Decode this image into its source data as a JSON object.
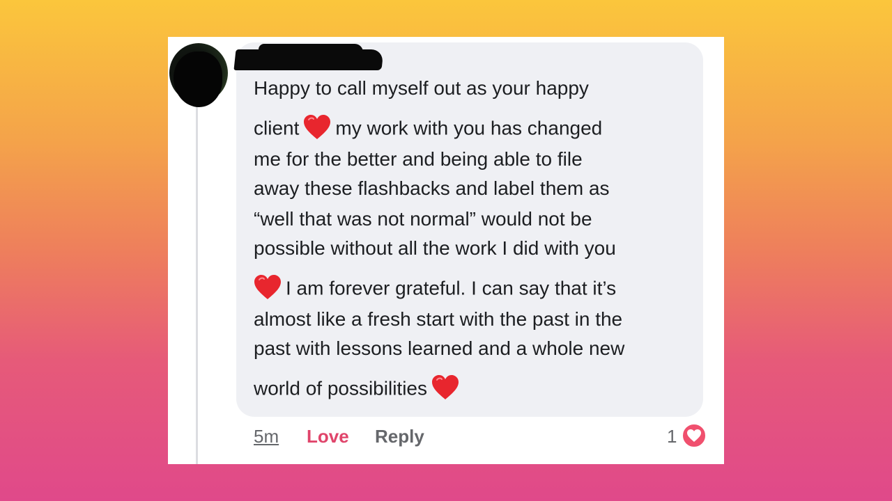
{
  "comment": {
    "lines": [
      [
        "Happy to call myself out as your happy",
        "",
        ""
      ],
      [
        "client",
        "red-heart-emoji",
        "my work with you has changed"
      ],
      [
        "me for the better and being able to file",
        "",
        ""
      ],
      [
        "away these flashbacks and label them as",
        "",
        ""
      ],
      [
        "“well that was not normal” would not be",
        "",
        ""
      ],
      [
        "possible without all the work I did with you",
        "",
        ""
      ],
      [
        "",
        "red-heart-emoji",
        "I am forever grateful. I can say that it’s"
      ],
      [
        "almost like a fresh start with the past in the",
        "",
        ""
      ],
      [
        "past with lessons learned and a whole new",
        "",
        ""
      ],
      [
        "world of possibilities",
        "red-heart-emoji",
        ""
      ]
    ]
  },
  "actions": {
    "time": "5m",
    "love_label": "Love",
    "reply_label": "Reply"
  },
  "reactions": {
    "count": "1",
    "icon": "heart-reaction-icon"
  },
  "colors": {
    "bubble": "#eff0f4",
    "love": "#e0456b",
    "heart_emoji": "#e8262e",
    "reaction": "#f0506e"
  }
}
